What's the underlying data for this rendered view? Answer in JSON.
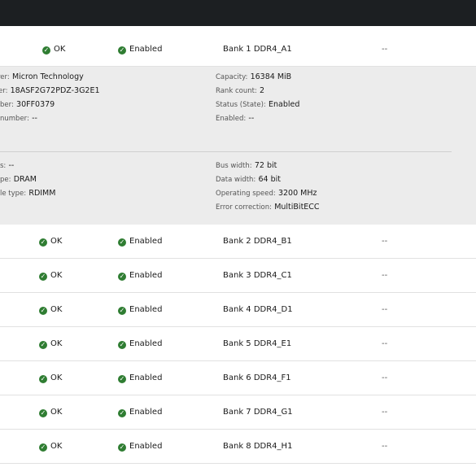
{
  "row1": {
    "status": "OK",
    "state": "Enabled",
    "location": "Bank 1 DDR4_A1",
    "serial": "--"
  },
  "details": {
    "col1": [
      {
        "k": "rer:",
        "v": "Micron Technology"
      },
      {
        "k": "er:",
        "v": "18ASF2G72PDZ-3G2E1"
      },
      {
        "k": "ber:",
        "v": "30FF0379"
      },
      {
        "k": "number:",
        "v": "--"
      }
    ],
    "col2": [
      {
        "k": "Capacity:",
        "v": "16384 MiB"
      },
      {
        "k": "Rank count:",
        "v": "2"
      },
      {
        "k": "Status (State):",
        "v": "Enabled"
      },
      {
        "k": "Enabled:",
        "v": "--"
      }
    ],
    "col3": [
      {
        "k": "s:",
        "v": "--"
      },
      {
        "k": "pe:",
        "v": "DRAM"
      },
      {
        "k": "le type:",
        "v": "RDIMM"
      }
    ],
    "col4": [
      {
        "k": "Bus width:",
        "v": "72 bit"
      },
      {
        "k": "Data width:",
        "v": "64 bit"
      },
      {
        "k": "Operating speed:",
        "v": "3200 MHz"
      },
      {
        "k": "Error correction:",
        "v": "MultiBitECC"
      }
    ]
  },
  "rows": [
    {
      "status": "OK",
      "state": "Enabled",
      "location": "Bank 2 DDR4_B1",
      "serial": "--"
    },
    {
      "status": "OK",
      "state": "Enabled",
      "location": "Bank 3 DDR4_C1",
      "serial": "--"
    },
    {
      "status": "OK",
      "state": "Enabled",
      "location": "Bank 4 DDR4_D1",
      "serial": "--"
    },
    {
      "status": "OK",
      "state": "Enabled",
      "location": "Bank 5 DDR4_E1",
      "serial": "--"
    },
    {
      "status": "OK",
      "state": "Enabled",
      "location": "Bank 6 DDR4_F1",
      "serial": "--"
    },
    {
      "status": "OK",
      "state": "Enabled",
      "location": "Bank 7 DDR4_G1",
      "serial": "--"
    },
    {
      "status": "OK",
      "state": "Enabled",
      "location": "Bank 8 DDR4_H1",
      "serial": "--"
    }
  ]
}
